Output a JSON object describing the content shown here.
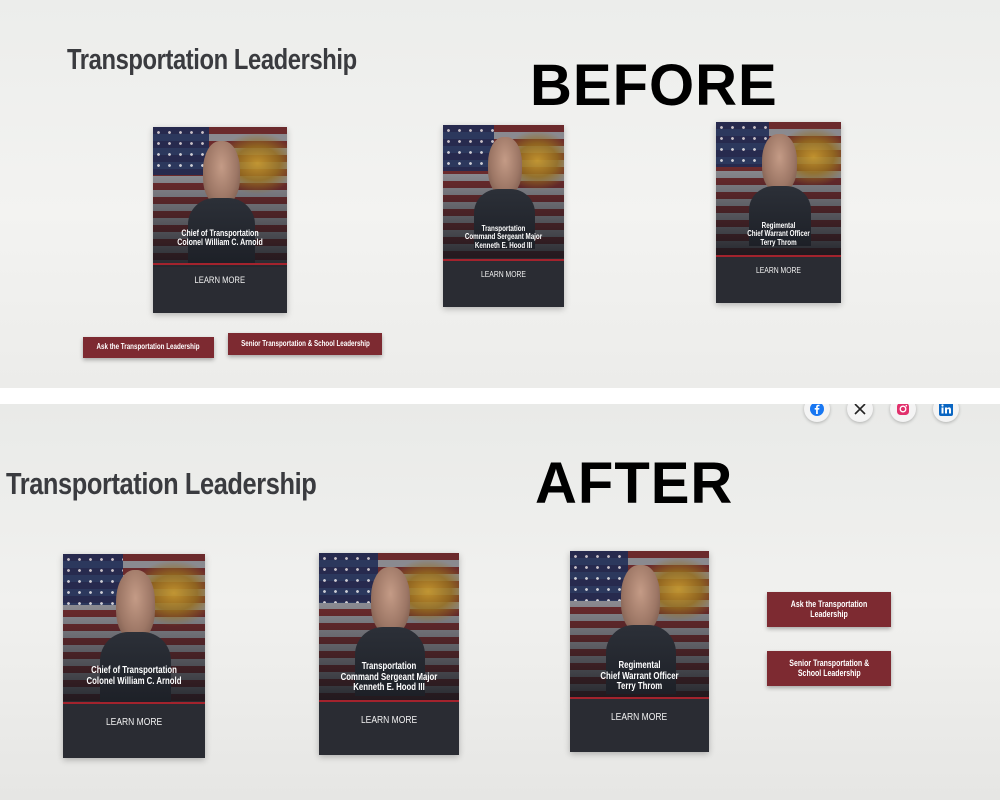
{
  "before": {
    "label": "BEFORE",
    "title": "Transportation Leadership",
    "cards": [
      {
        "lines": [
          "Chief of Transportation",
          "Colonel William C. Arnold"
        ],
        "button": "LEARN MORE"
      },
      {
        "lines": [
          "Transportation",
          "Command Sergeant Major",
          "Kenneth E. Hood III"
        ],
        "button": "LEARN MORE"
      },
      {
        "lines": [
          "Regimental",
          "Chief Warrant Officer",
          "Terry Throm"
        ],
        "button": "LEARN MORE"
      }
    ],
    "buttons": [
      "Ask the Transportation Leadership",
      "Senior Transportation & School Leadership"
    ]
  },
  "after": {
    "label": "AFTER",
    "title": "Transportation Leadership",
    "cards": [
      {
        "lines": [
          "Chief of Transportation",
          "Colonel William C. Arnold"
        ],
        "button": "LEARN MORE"
      },
      {
        "lines": [
          "Transportation",
          "Command Sergeant Major",
          "Kenneth E. Hood III"
        ],
        "button": "LEARN MORE"
      },
      {
        "lines": [
          "Regimental",
          "Chief Warrant Officer",
          "Terry Throm"
        ],
        "button": "LEARN MORE"
      }
    ],
    "buttons": [
      {
        "lines": [
          "Ask the Transportation",
          "Leadership"
        ]
      },
      {
        "lines": [
          "Senior Transportation &",
          "School Leadership"
        ]
      }
    ],
    "social_icons": [
      "facebook-icon",
      "x-icon",
      "instagram-icon",
      "linkedin-icon"
    ]
  },
  "colors": {
    "accent_maroon": "#7d2a31",
    "card_bg": "#2a2c33",
    "rule_red": "#a3232d",
    "title_gray": "#3a3b3f"
  }
}
